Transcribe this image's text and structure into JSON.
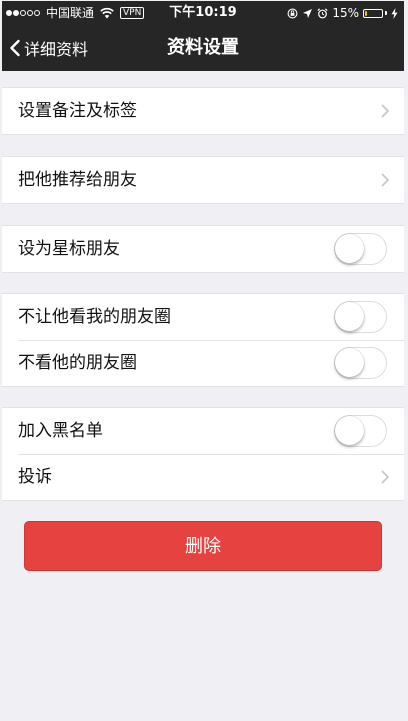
{
  "status_bar": {
    "carrier": "中国联通",
    "vpn": "VPN",
    "time": "下午10:19",
    "battery_text": "15%",
    "battery_level": 0.15,
    "battery_color": "#f2c318"
  },
  "nav": {
    "back_label": "详细资料",
    "title": "资料设置"
  },
  "groups": [
    {
      "rows": [
        {
          "label": "设置备注及标签",
          "control": "chevron"
        }
      ]
    },
    {
      "rows": [
        {
          "label": "把他推荐给朋友",
          "control": "chevron"
        }
      ]
    },
    {
      "rows": [
        {
          "label": "设为星标朋友",
          "control": "toggle",
          "on": false
        }
      ]
    },
    {
      "rows": [
        {
          "label": "不让他看我的朋友圈",
          "control": "toggle",
          "on": false
        },
        {
          "label": "不看他的朋友圈",
          "control": "toggle",
          "on": false
        }
      ]
    },
    {
      "rows": [
        {
          "label": "加入黑名单",
          "control": "toggle",
          "on": false
        },
        {
          "label": "投诉",
          "control": "chevron"
        }
      ]
    }
  ],
  "delete_button": {
    "label": "删除",
    "color": "#e64340"
  },
  "icons": {
    "back": "chevron-left-icon",
    "row_arrow": "chevron-right-icon",
    "wifi": "wifi-icon",
    "lock_rotation": "rotation-lock-icon",
    "location": "location-arrow-icon",
    "alarm": "alarm-clock-icon",
    "battery": "battery-icon",
    "charging": "charging-bolt-icon"
  }
}
